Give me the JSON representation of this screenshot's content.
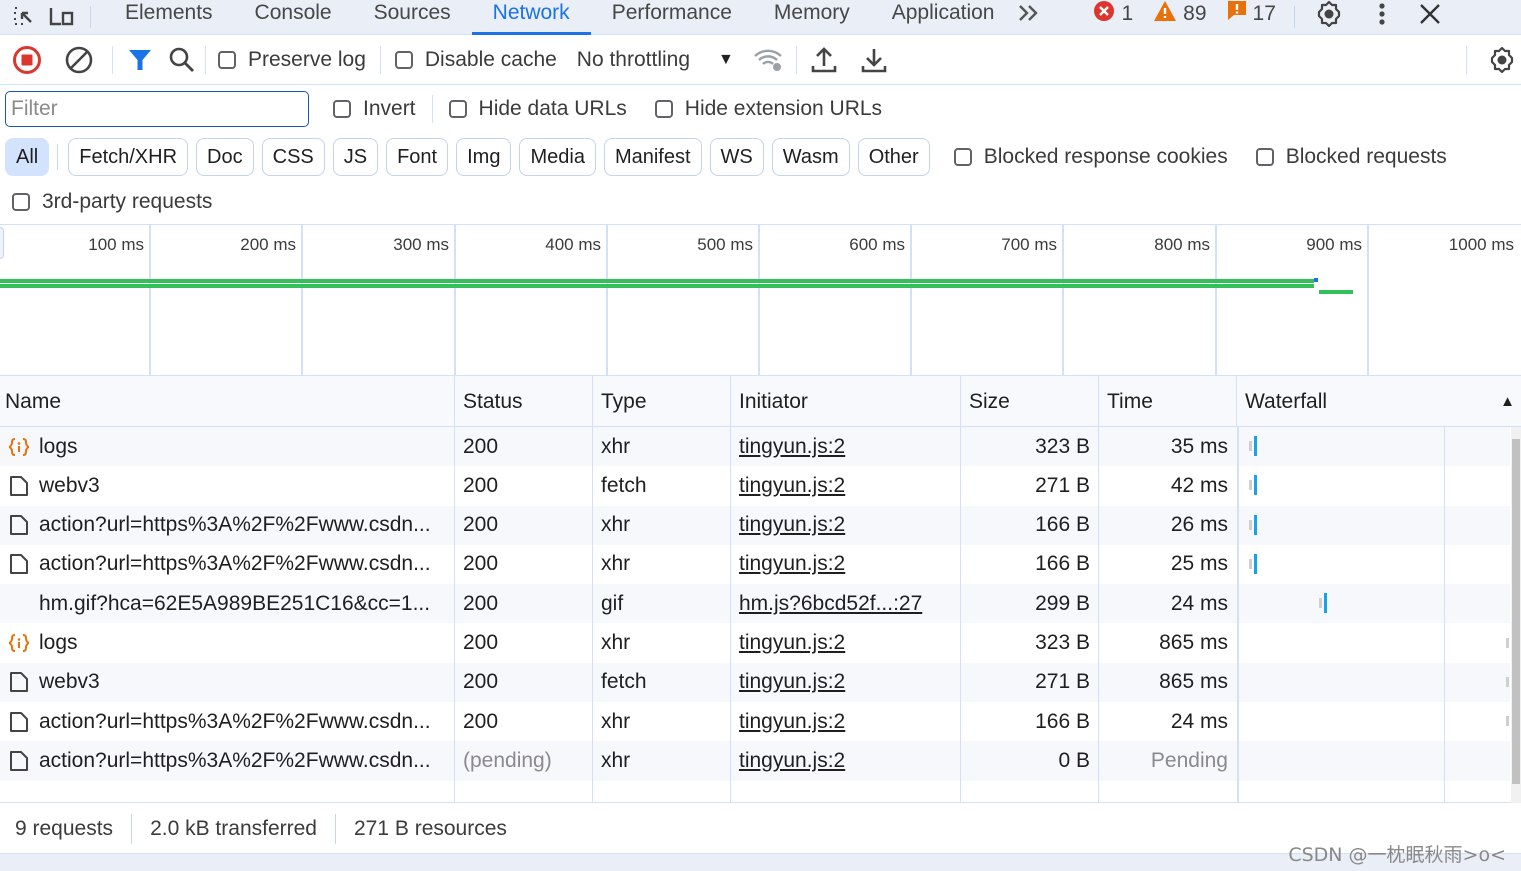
{
  "tabs": {
    "items": [
      {
        "label": "Elements",
        "active": false
      },
      {
        "label": "Console",
        "active": false
      },
      {
        "label": "Sources",
        "active": false
      },
      {
        "label": "Network",
        "active": true
      },
      {
        "label": "Performance",
        "active": false
      },
      {
        "label": "Memory",
        "active": false
      },
      {
        "label": "Application",
        "active": false
      }
    ],
    "more_icon": "chevron-double-right-icon",
    "errors": "1",
    "warnings": "89",
    "issues": "17"
  },
  "toolbar": {
    "preserve_log": "Preserve log",
    "disable_cache": "Disable cache",
    "throttling": "No throttling"
  },
  "filter": {
    "placeholder": "Filter",
    "value": "",
    "invert": "Invert",
    "hide_data_urls": "Hide data URLs",
    "hide_extension_urls": "Hide extension URLs"
  },
  "types": {
    "chips": [
      "All",
      "Fetch/XHR",
      "Doc",
      "CSS",
      "JS",
      "Font",
      "Img",
      "Media",
      "Manifest",
      "WS",
      "Wasm",
      "Other"
    ],
    "active": "All",
    "blocked_response_cookies": "Blocked response cookies",
    "blocked_requests": "Blocked requests",
    "third_party": "3rd-party requests"
  },
  "overview": {
    "ticks": [
      "100 ms",
      "200 ms",
      "300 ms",
      "400 ms",
      "500 ms",
      "600 ms",
      "700 ms",
      "800 ms",
      "900 ms",
      "1000 ms"
    ],
    "colors": {
      "green": "#34c058",
      "blue": "#1a73e8"
    }
  },
  "table": {
    "columns": [
      "Name",
      "Status",
      "Type",
      "Initiator",
      "Size",
      "Time",
      "Waterfall"
    ],
    "sort_indicator": "▲",
    "rows": [
      {
        "icon": "xhr",
        "name": "logs",
        "status": "200",
        "type": "xhr",
        "initiator": "tingyun.js:2",
        "size": "323 B",
        "time": "35 ms",
        "wf": 0.02
      },
      {
        "icon": "doc",
        "name": "webv3",
        "status": "200",
        "type": "fetch",
        "initiator": "tingyun.js:2",
        "size": "271 B",
        "time": "42 ms",
        "wf": 0.02
      },
      {
        "icon": "doc",
        "name": "action?url=https%3A%2F%2Fwww.csdn...",
        "status": "200",
        "type": "xhr",
        "initiator": "tingyun.js:2",
        "size": "166 B",
        "time": "26 ms",
        "wf": 0.02
      },
      {
        "icon": "doc",
        "name": "action?url=https%3A%2F%2Fwww.csdn...",
        "status": "200",
        "type": "xhr",
        "initiator": "tingyun.js:2",
        "size": "166 B",
        "time": "25 ms",
        "wf": 0.02
      },
      {
        "icon": "none",
        "name": "hm.gif?hca=62E5A989BE251C16&cc=1...",
        "status": "200",
        "type": "gif",
        "initiator": "hm.js?6bcd52f...:27",
        "size": "299 B",
        "time": "24 ms",
        "wf": 0.29
      },
      {
        "icon": "xhr",
        "name": "logs",
        "status": "200",
        "type": "xhr",
        "initiator": "tingyun.js:2",
        "size": "323 B",
        "time": "865 ms",
        "wf": null
      },
      {
        "icon": "doc",
        "name": "webv3",
        "status": "200",
        "type": "fetch",
        "initiator": "tingyun.js:2",
        "size": "271 B",
        "time": "865 ms",
        "wf": null
      },
      {
        "icon": "doc",
        "name": "action?url=https%3A%2F%2Fwww.csdn...",
        "status": "200",
        "type": "xhr",
        "initiator": "tingyun.js:2",
        "size": "166 B",
        "time": "24 ms",
        "wf": null
      },
      {
        "icon": "doc",
        "name": "action?url=https%3A%2F%2Fwww.csdn...",
        "status": "(pending)",
        "type": "xhr",
        "initiator": "tingyun.js:2",
        "size": "0 B",
        "time": "Pending",
        "wf": null
      }
    ]
  },
  "status": {
    "requests": "9 requests",
    "transferred": "2.0 kB transferred",
    "resources": "271 B resources"
  },
  "watermark": "CSDN @一枕眠秋雨>o<"
}
